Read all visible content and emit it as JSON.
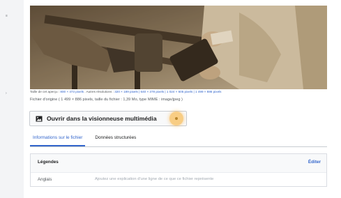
{
  "rail": {
    "mark_top": "≡",
    "mark_mid": "›"
  },
  "file_info": {
    "sizes_prefix": "Taille de cet aperçu :",
    "preview_size": "800 × 473 pixels",
    "other_resolutions_label": ". Autres résolutions :",
    "other_resolutions": "320 × 189 pixels | 640 × 378 pixels | 1 024 × 605 pixels | 1 499 × 886 pixels",
    "origin_text": "Fichier d'origine  ( 1 499 × 886 pixels, taille du fichier : 1,39 Mo, type MIME : image/jpeg )"
  },
  "viewer_button": {
    "label": "Ouvrir dans la visionneuse multimédia",
    "icon": "image-icon"
  },
  "tabs": [
    {
      "label": "Informations sur le fichier",
      "active": true
    },
    {
      "label": "Données structurées",
      "active": false
    }
  ],
  "captions": {
    "heading": "Légendes",
    "edit_label": "Éditer",
    "language": "Anglais",
    "placeholder": "Ajoutez une explication d'une ligne de ce que ce fichier représente"
  },
  "colors": {
    "link": "#3366cc",
    "highlight": "#f8c66e"
  }
}
